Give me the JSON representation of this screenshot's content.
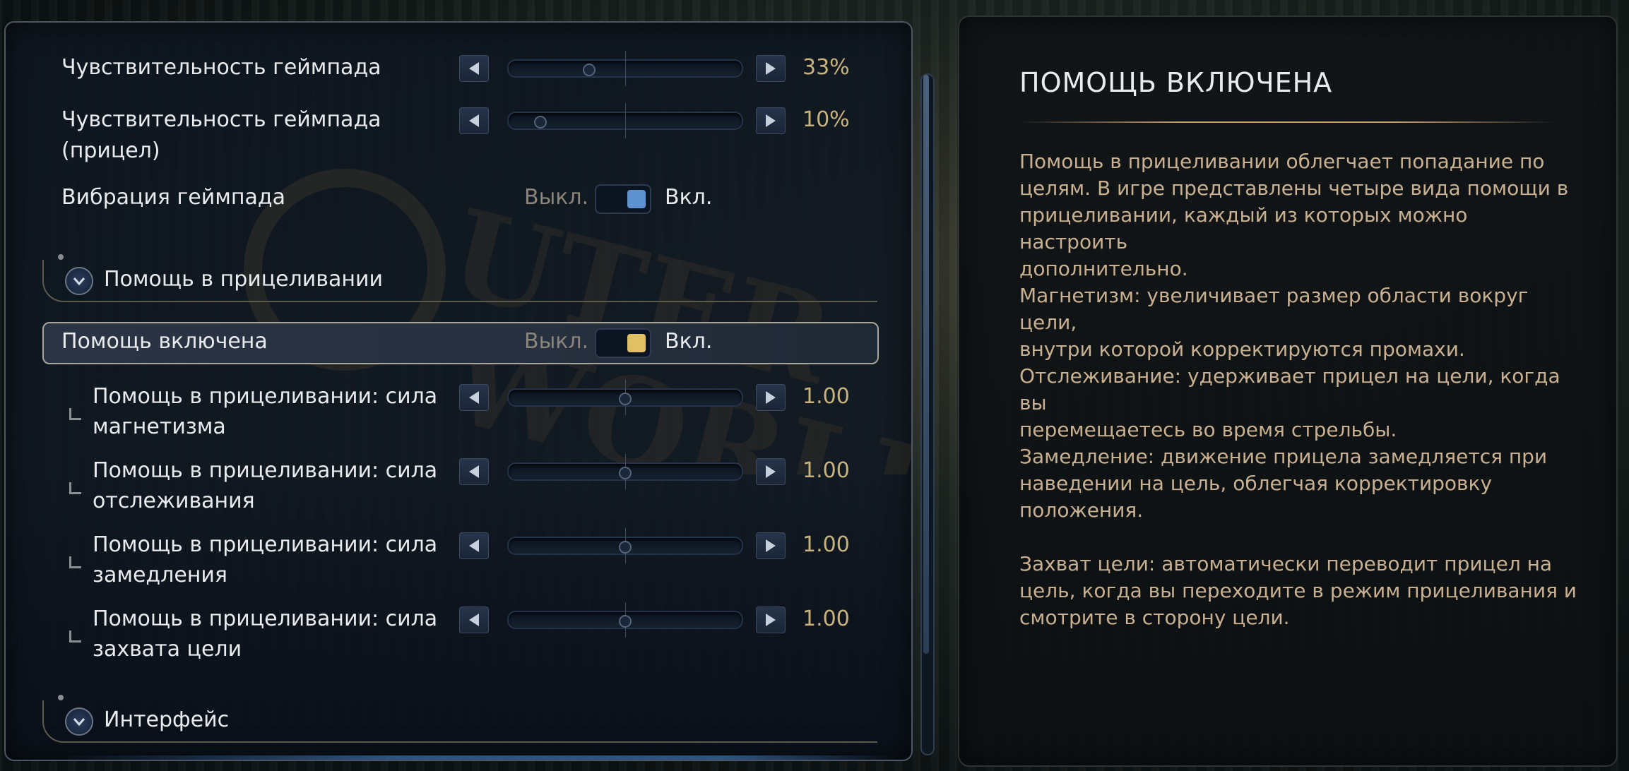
{
  "settings": {
    "gamepad_sensitivity": {
      "label": "Чувствительность геймпада",
      "value": "33%",
      "level": 0.33
    },
    "gamepad_sensitivity_aim": {
      "label_line1": "Чувствительность геймпада",
      "label_line2": "(прицел)",
      "value": "10%",
      "level": 0.1
    },
    "gamepad_vibration": {
      "label": "Вибрация геймпада",
      "off_label": "Выкл.",
      "on_label": "Вкл.",
      "state": "on",
      "dot_color": "#5f92d0"
    }
  },
  "aim_section": {
    "title": "Помощь в прицеливании",
    "enabled": {
      "label": "Помощь включена",
      "off_label": "Выкл.",
      "on_label": "Вкл.",
      "state": "on",
      "dot_color": "#e1c063"
    },
    "sub_settings": [
      {
        "line1": "Помощь в прицеливании: сила",
        "line2": "магнетизма",
        "value": "1.00",
        "level": 0.5
      },
      {
        "line1": "Помощь в прицеливании: сила",
        "line2": "отслеживания",
        "value": "1.00",
        "level": 0.5
      },
      {
        "line1": "Помощь в прицеливании: сила",
        "line2": "замедления",
        "value": "1.00",
        "level": 0.5
      },
      {
        "line1": "Помощь в прицеливании: сила",
        "line2": "захвата цели",
        "value": "1.00",
        "level": 0.5
      }
    ]
  },
  "interface_section": {
    "title": "Интерфейс"
  },
  "info_panel": {
    "title": "ПОМОЩЬ ВКЛЮЧЕНА",
    "paragraphs": [
      [
        "Помощь в прицеливании облегчает попадание по",
        "целям. В игре представлены четыре вида помощи в",
        "прицеливании, каждый из которых можно настроить",
        "дополнительно."
      ],
      [
        "Магнетизм: увеличивает размер области вокруг цели,",
        "внутри которой корректируются промахи."
      ],
      [
        "Отслеживание: удерживает прицел на цели, когда вы",
        "перемещаетесь во время стрельбы."
      ],
      [
        "Замедление: движение прицела замедляется при",
        "наведении на цель, облегчая корректировку",
        "положения."
      ],
      [
        "Захват цели: автоматически переводит прицел на",
        "цель, когда вы переходите в режим прицеливания и",
        "смотрите в сторону цели."
      ]
    ]
  },
  "colors": {
    "accent_gold": "#c8b27e",
    "info_text": "#c8b090",
    "panel_border": "#4e5663"
  },
  "icons": {
    "left_arrow": "triangle-left-icon",
    "right_arrow": "triangle-right-icon",
    "section_toggle": "chevron-down-icon"
  }
}
